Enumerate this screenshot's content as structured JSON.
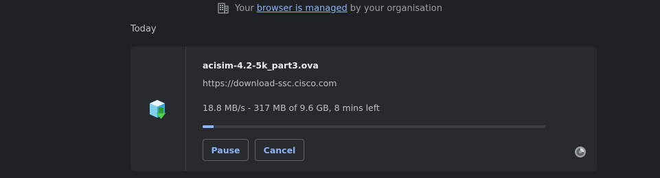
{
  "banner": {
    "prefix": "Your",
    "link": "browser is managed",
    "suffix": "by your organisation",
    "icon": "building-icon"
  },
  "section": {
    "title": "Today"
  },
  "download": {
    "file_name": "acisim-4.2-5k_part3.ova",
    "url": "https://download-ssc.cisco.com",
    "status": "18.8 MB/s - 317 MB of 9.6 GB, 8 mins left",
    "progress_fraction": 0.033,
    "file_icon": "package-download-icon",
    "buttons": {
      "pause": "Pause",
      "cancel": "Cancel"
    },
    "corner_icon": "spinner-icon"
  },
  "colors": {
    "background": "#202124",
    "card": "#292a2d",
    "accent": "#8ab4f8",
    "text": "#e8eaed",
    "muted": "#bdc1c6"
  }
}
